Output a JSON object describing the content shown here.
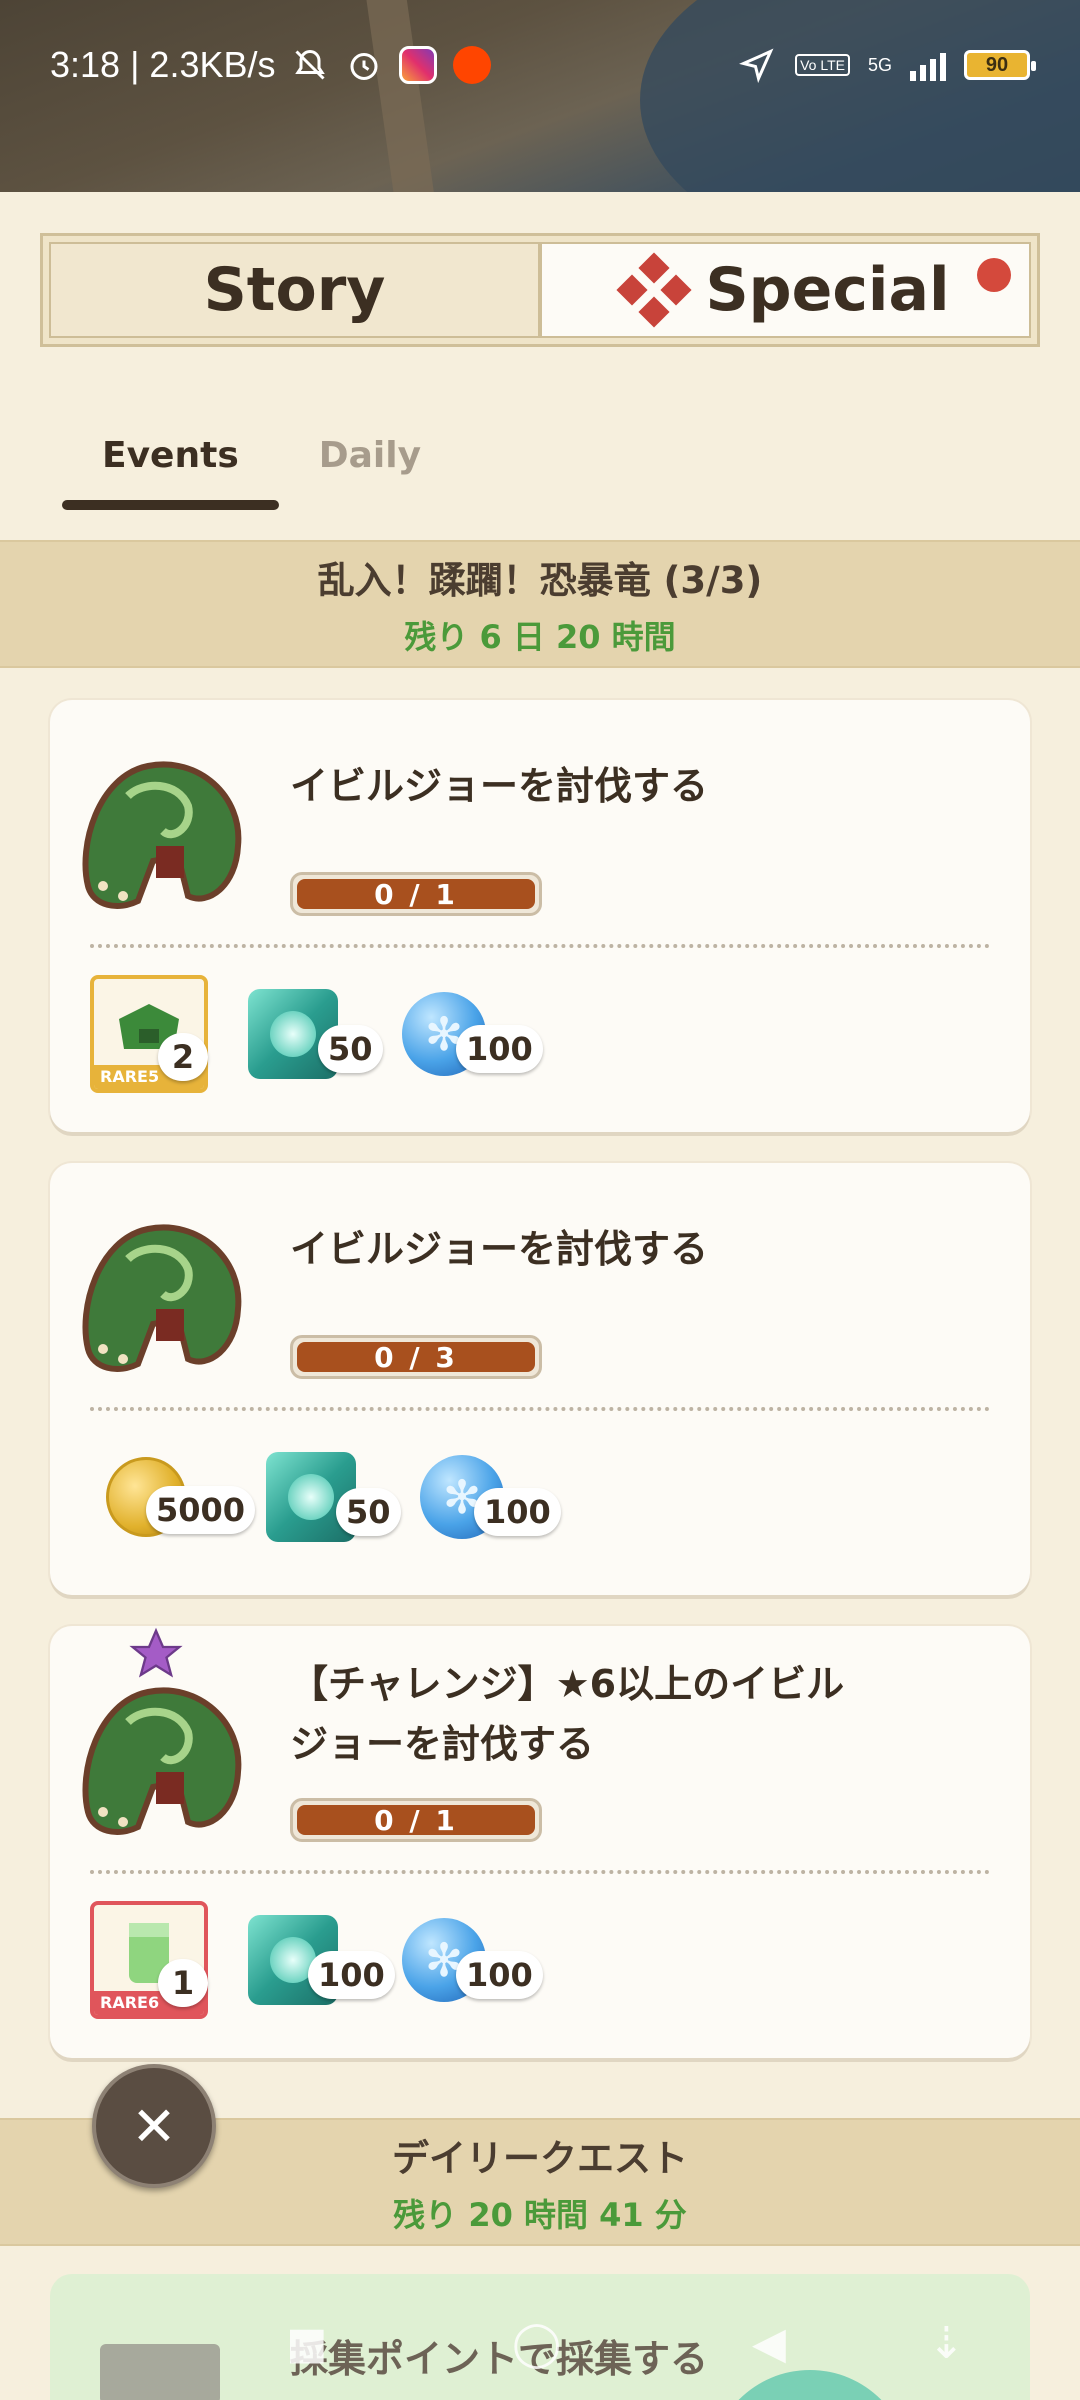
{
  "status_bar": {
    "time_speed": "3:18 | 2.3KB/s",
    "network": "5G",
    "volte": "Vo LTE",
    "battery": "90"
  },
  "segment": {
    "story_label": "Story",
    "special_label": "Special"
  },
  "subtabs": {
    "events": "Events",
    "daily": "Daily"
  },
  "event_banner": {
    "title": "乱入！蹂躙！恐暴竜 (3/3)",
    "remaining": "残り 6 日 20 時間"
  },
  "quests": [
    {
      "task": "イビルジョーを討伐する",
      "progress_text": "0 / 1",
      "progress": 0,
      "rewards": {
        "item_rarity": "RARE5",
        "item_count": "2",
        "gem_count": "50",
        "orb_count": "100"
      }
    },
    {
      "task": "イビルジョーを討伐する",
      "progress_text": "0 / 3",
      "progress": 0,
      "rewards": {
        "coin_count": "5000",
        "gem_count": "50",
        "orb_count": "100"
      }
    },
    {
      "task_line1": "【チャレンジ】★6以上のイビル",
      "task_line2": "ジョーを討伐する",
      "progress_text": "0 / 1",
      "progress": 0,
      "rewards": {
        "item_rarity": "RARE6",
        "item_count": "1",
        "gem_count": "100",
        "orb_count": "100"
      }
    }
  ],
  "daily_banner": {
    "title": "デイリークエスト",
    "remaining": "残り 20 時間 41 分"
  },
  "daily_quest": {
    "task": "採集ポイントで採集する"
  },
  "colors": {
    "accent_red": "#d4493c",
    "progress_fill": "#a8501e",
    "remaining_green": "#4b9a3a",
    "banner_bg": "#e4d4ae"
  }
}
